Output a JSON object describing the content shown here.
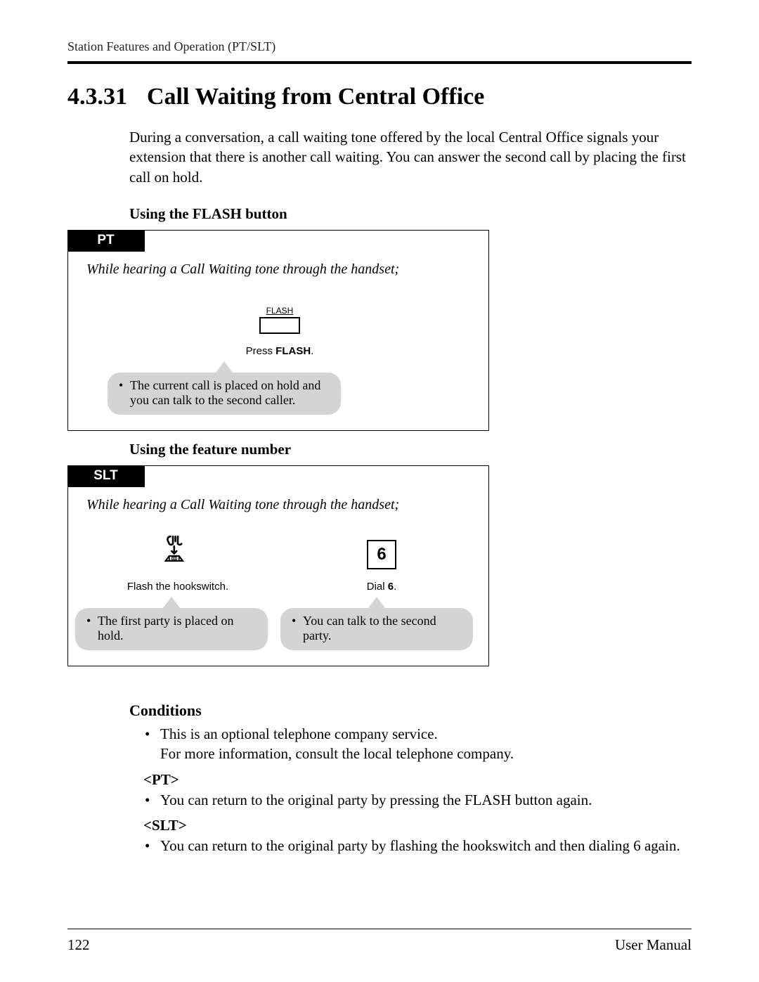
{
  "header": {
    "running": "Station Features and Operation (PT/SLT)"
  },
  "section": {
    "number": "4.3.31",
    "title": "Call Waiting from Central Office",
    "intro": "During a conversation, a call waiting tone offered by the local Central Office signals your extension that there is another call waiting. You can answer the second call by placing the first call on hold."
  },
  "proc_a": {
    "heading": "Using the FLASH button",
    "tab": "PT",
    "lead": "While hearing a Call Waiting tone through the handset;",
    "flash_label": "FLASH",
    "step1_cap_pre": "Press ",
    "step1_cap_bold": "FLASH",
    "step1_cap_post": ".",
    "bubble1": "The current call is placed on hold and you can talk to the second caller."
  },
  "proc_b": {
    "heading": "Using the feature number",
    "tab": "SLT",
    "lead": "While hearing a Call Waiting tone through the handset;",
    "dial_digit": "6",
    "step1_cap": "Flash the hookswitch.",
    "step2_cap_pre": "Dial ",
    "step2_cap_bold": "6",
    "step2_cap_post": ".",
    "bubble1": "The first party is placed on hold.",
    "bubble2": "You can talk to the second party."
  },
  "conditions": {
    "title": "Conditions",
    "item1a": "This is an optional telephone company service.",
    "item1b": "For more information, consult the local telephone company.",
    "pt_label": "<PT>",
    "pt_item": "You can return to the original party by pressing the FLASH button again.",
    "slt_label": "<SLT>",
    "slt_item": "You can return to the original party by flashing the hookswitch and then dialing 6 again."
  },
  "footer": {
    "page": "122",
    "doc": "User Manual"
  }
}
